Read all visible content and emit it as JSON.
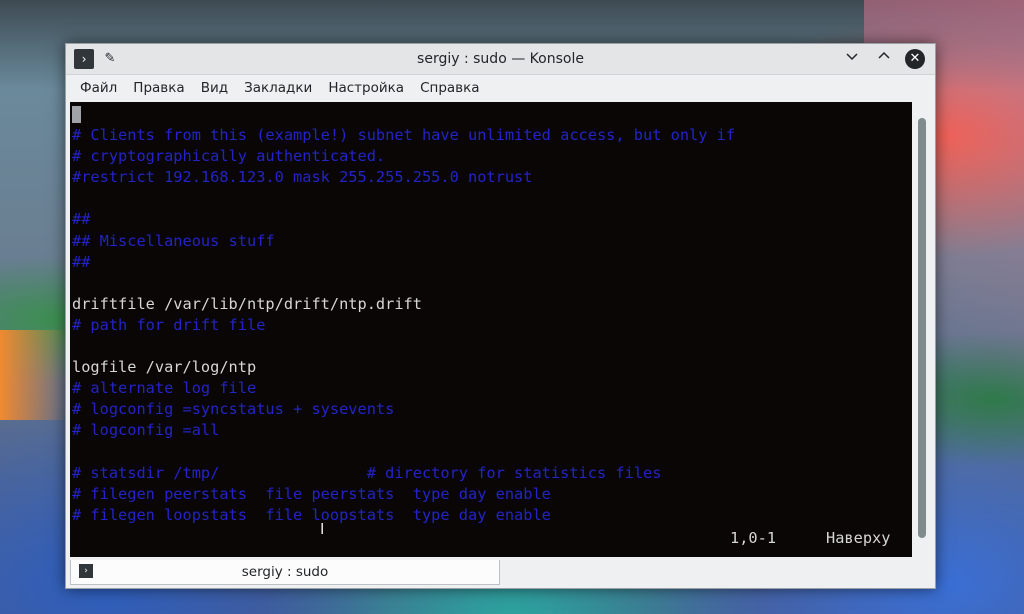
{
  "window": {
    "title": "sergiy : sudo — Konsole",
    "app_icon_glyph": "›",
    "pin_glyph": "📌",
    "minimize_glyph": "⌄",
    "maximize_glyph": "⌃",
    "close_glyph": "✕"
  },
  "menubar": {
    "items": [
      "Файл",
      "Правка",
      "Вид",
      "Закладки",
      "Настройка",
      "Справка"
    ]
  },
  "terminal": {
    "lines": [
      {
        "text": "# Clients from this (example!) subnet have unlimited access, but only if",
        "style": "comment"
      },
      {
        "text": "# cryptographically authenticated.",
        "style": "comment"
      },
      {
        "text": "#restrict 192.168.123.0 mask 255.255.255.0 notrust",
        "style": "comment"
      },
      {
        "text": "",
        "style": "text"
      },
      {
        "text": "##",
        "style": "comment"
      },
      {
        "text": "## Miscellaneous stuff",
        "style": "comment"
      },
      {
        "text": "##",
        "style": "comment"
      },
      {
        "text": "",
        "style": "text"
      },
      {
        "text": "driftfile /var/lib/ntp/drift/ntp.drift",
        "style": "text"
      },
      {
        "text": "# path for drift file",
        "style": "comment"
      },
      {
        "text": "",
        "style": "text"
      },
      {
        "text": "logfile /var/log/ntp",
        "style": "text"
      },
      {
        "text": "# alternate log file",
        "style": "comment"
      },
      {
        "text": "# logconfig =syncstatus + sysevents",
        "style": "comment"
      },
      {
        "text": "# logconfig =all",
        "style": "comment"
      },
      {
        "text": "",
        "style": "text"
      },
      {
        "text": "# statsdir /tmp/                # directory for statistics files",
        "style": "comment"
      },
      {
        "text": "# filegen peerstats  file peerstats  type day enable",
        "style": "comment"
      },
      {
        "text": "# filegen loopstats  file loopstats  type day enable",
        "style": "comment"
      }
    ],
    "status_position": "1,0-1",
    "status_view": "Наверху"
  },
  "tabs": [
    {
      "label": "sergiy : sudo",
      "icon": "terminal-icon"
    }
  ],
  "colors": {
    "comment": "#2323c8",
    "text": "#d6d6d6",
    "terminal_bg": "#0a0606"
  }
}
